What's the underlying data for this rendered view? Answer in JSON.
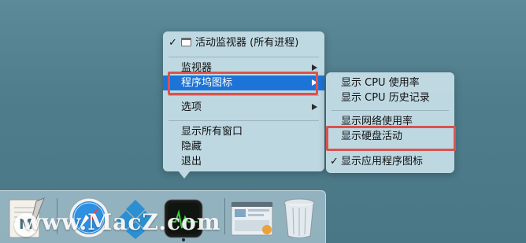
{
  "main_menu": {
    "items": [
      {
        "label": "活动监视器 (所有进程)",
        "checked": true,
        "has_window_icon": true
      },
      {
        "label": "监视器",
        "submenu": true
      },
      {
        "label": "程序坞图标",
        "submenu": true,
        "selected": true
      },
      {
        "label": "选项",
        "submenu": true
      },
      {
        "label": "显示所有窗口"
      },
      {
        "label": "隐藏"
      },
      {
        "label": "退出"
      }
    ]
  },
  "sub_menu": {
    "items": [
      {
        "label": "显示 CPU 使用率"
      },
      {
        "label": "显示 CPU 历史记录"
      },
      {
        "label": "显示网络使用率"
      },
      {
        "label": "显示硬盘活动"
      },
      {
        "label": "显示应用程序图标",
        "checked": true
      }
    ]
  },
  "symbols": {
    "check": "✓"
  },
  "dock": {
    "apps": [
      "textedit-icon",
      "safari-icon",
      "kodi-icon",
      "activity-monitor-icon",
      "screenshot-icon",
      "trash-icon"
    ]
  },
  "watermark": {
    "text": "www.MacZ.com",
    "logo_letter": "M"
  },
  "colors": {
    "selection": "#1d74d8",
    "highlight_box": "#d9534f"
  }
}
